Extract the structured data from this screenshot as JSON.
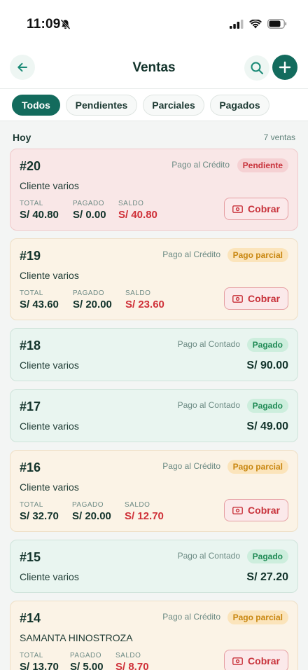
{
  "status": {
    "time": "11:09"
  },
  "header": {
    "title": "Ventas"
  },
  "filters": [
    "Todos",
    "Pendientes",
    "Parciales",
    "Pagados"
  ],
  "section": {
    "label": "Hoy",
    "count": "7 ventas"
  },
  "money_labels": {
    "total": "TOTAL",
    "paid": "PAGADO",
    "balance": "SALDO"
  },
  "action_label": "Cobrar",
  "colors": {
    "primary": "#136b5d",
    "danger": "#c8323b",
    "warning": "#c8860f",
    "success": "#1f8a55"
  },
  "sales": [
    {
      "number": "#20",
      "client": "Cliente varios",
      "pay_type": "Pago al Crédito",
      "status": "Pendiente",
      "total": "S/ 40.80",
      "paid": "S/ 0.00",
      "balance": "S/ 40.80"
    },
    {
      "number": "#19",
      "client": "Cliente varios",
      "pay_type": "Pago al Crédito",
      "status": "Pago parcial",
      "total": "S/ 43.60",
      "paid": "S/ 20.00",
      "balance": "S/ 23.60"
    },
    {
      "number": "#18",
      "client": "Cliente varios",
      "pay_type": "Pago al Contado",
      "status": "Pagado",
      "total": "S/ 90.00"
    },
    {
      "number": "#17",
      "client": "Cliente varios",
      "pay_type": "Pago al Contado",
      "status": "Pagado",
      "total": "S/ 49.00"
    },
    {
      "number": "#16",
      "client": "Cliente varios",
      "pay_type": "Pago al Crédito",
      "status": "Pago parcial",
      "total": "S/ 32.70",
      "paid": "S/ 20.00",
      "balance": "S/ 12.70"
    },
    {
      "number": "#15",
      "client": "Cliente varios",
      "pay_type": "Pago al Contado",
      "status": "Pagado",
      "total": "S/ 27.20"
    },
    {
      "number": "#14",
      "client": "SAMANTA HINOSTROZA",
      "pay_type": "Pago al Crédito",
      "status": "Pago parcial",
      "total": "S/ 13.70",
      "paid": "S/ 5.00",
      "balance": "S/ 8.70"
    }
  ]
}
